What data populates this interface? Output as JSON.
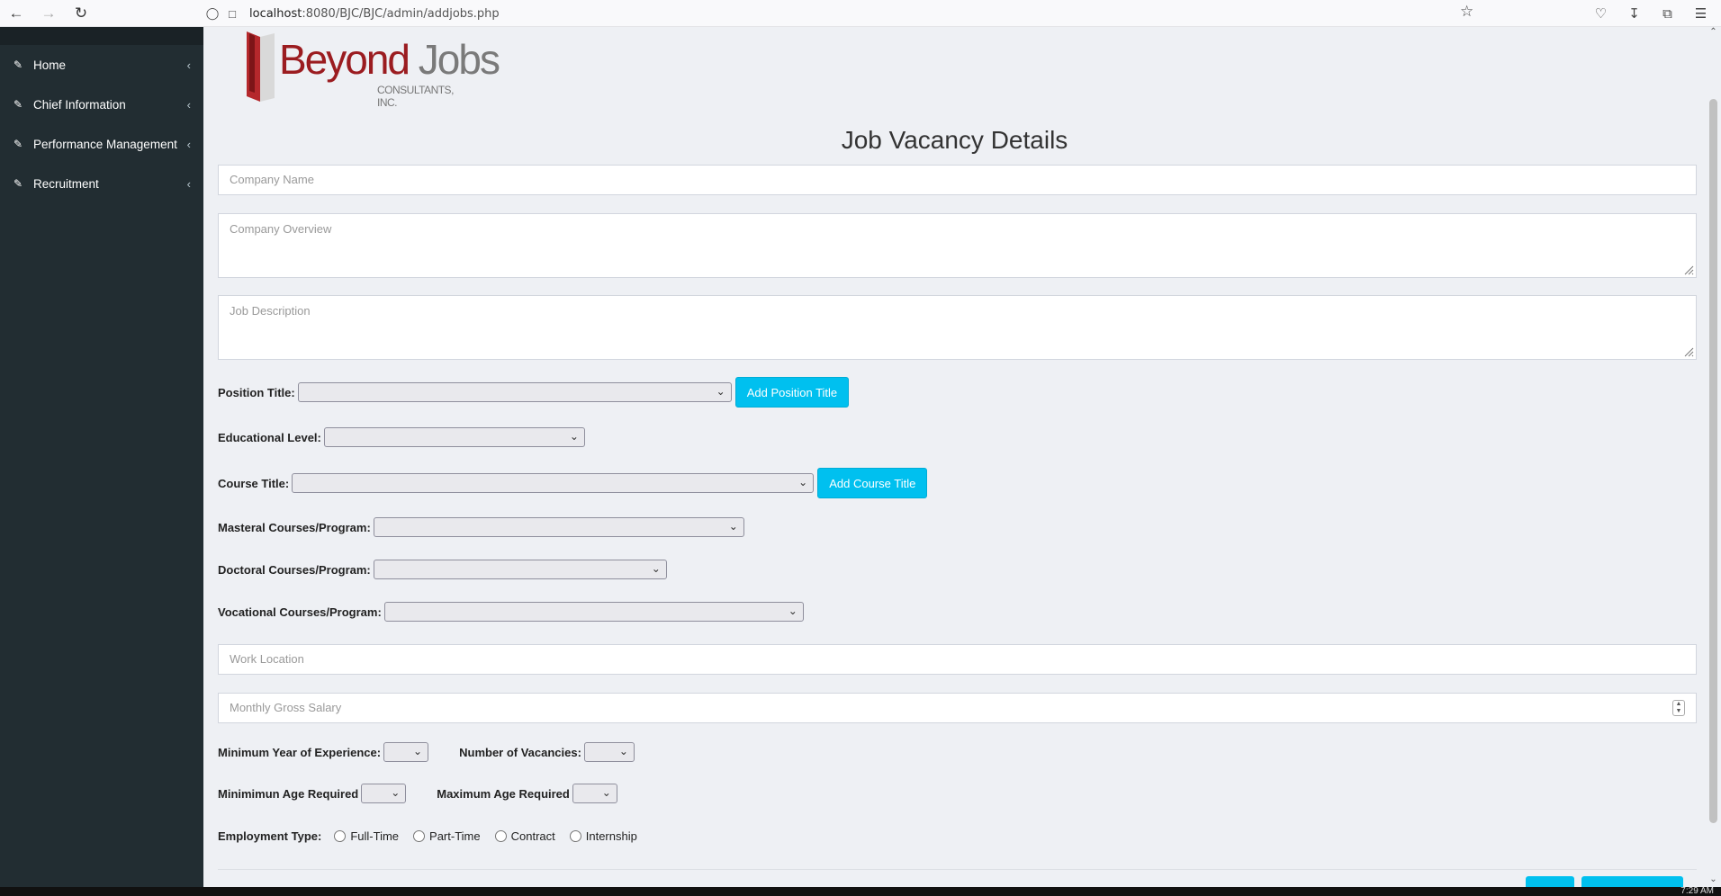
{
  "browser": {
    "url_host": "localhost",
    "url_rest": ":8080/BJC/BJC/admin/addjobs.php",
    "icons": [
      "back-arrow-icon",
      "forward-arrow-icon",
      "reload-icon",
      "shield-icon",
      "page-icon",
      "star-icon",
      "pocket-icon",
      "download-icon",
      "extensions-icon",
      "menu-icon"
    ]
  },
  "sidebar": {
    "items": [
      {
        "label": "Home"
      },
      {
        "label": "Chief Information"
      },
      {
        "label": "Performance Management"
      },
      {
        "label": "Recruitment"
      }
    ]
  },
  "logo": {
    "word1": "Beyond",
    "word2": "Jobs",
    "subtitle": "CONSULTANTS, INC."
  },
  "form": {
    "title": "Job Vacancy Details",
    "company_name_placeholder": "Company Name",
    "company_overview_placeholder": "Company Overview",
    "job_description_placeholder": "Job Description",
    "position_title_label": "Position Title:",
    "add_position_button": "Add Position Title",
    "educational_level_label": "Educational Level:",
    "course_title_label": "Course Title:",
    "add_course_button": "Add Course Title",
    "masteral_label": "Masteral Courses/Program:",
    "doctoral_label": "Doctoral Courses/Program:",
    "vocational_label": "Vocational Courses/Program:",
    "work_location_placeholder": "Work Location",
    "salary_placeholder": "Monthly Gross Salary",
    "min_experience_label": "Minimum Year of Experience:",
    "vacancies_label": "Number of Vacancies:",
    "min_age_label": "Minimimun Age Required",
    "max_age_label": "Maximum Age Required",
    "employment_type_label": "Employment Type:",
    "employment_types": [
      "Full-Time",
      "Part-Time",
      "Contract",
      "Internship"
    ]
  },
  "taskbar": {
    "time": "7:29 AM"
  },
  "colors": {
    "sidebar": "#222d32",
    "accent_button": "#00c0ef",
    "logo_red": "#9b1c20",
    "page_bg": "#eef0f4"
  }
}
